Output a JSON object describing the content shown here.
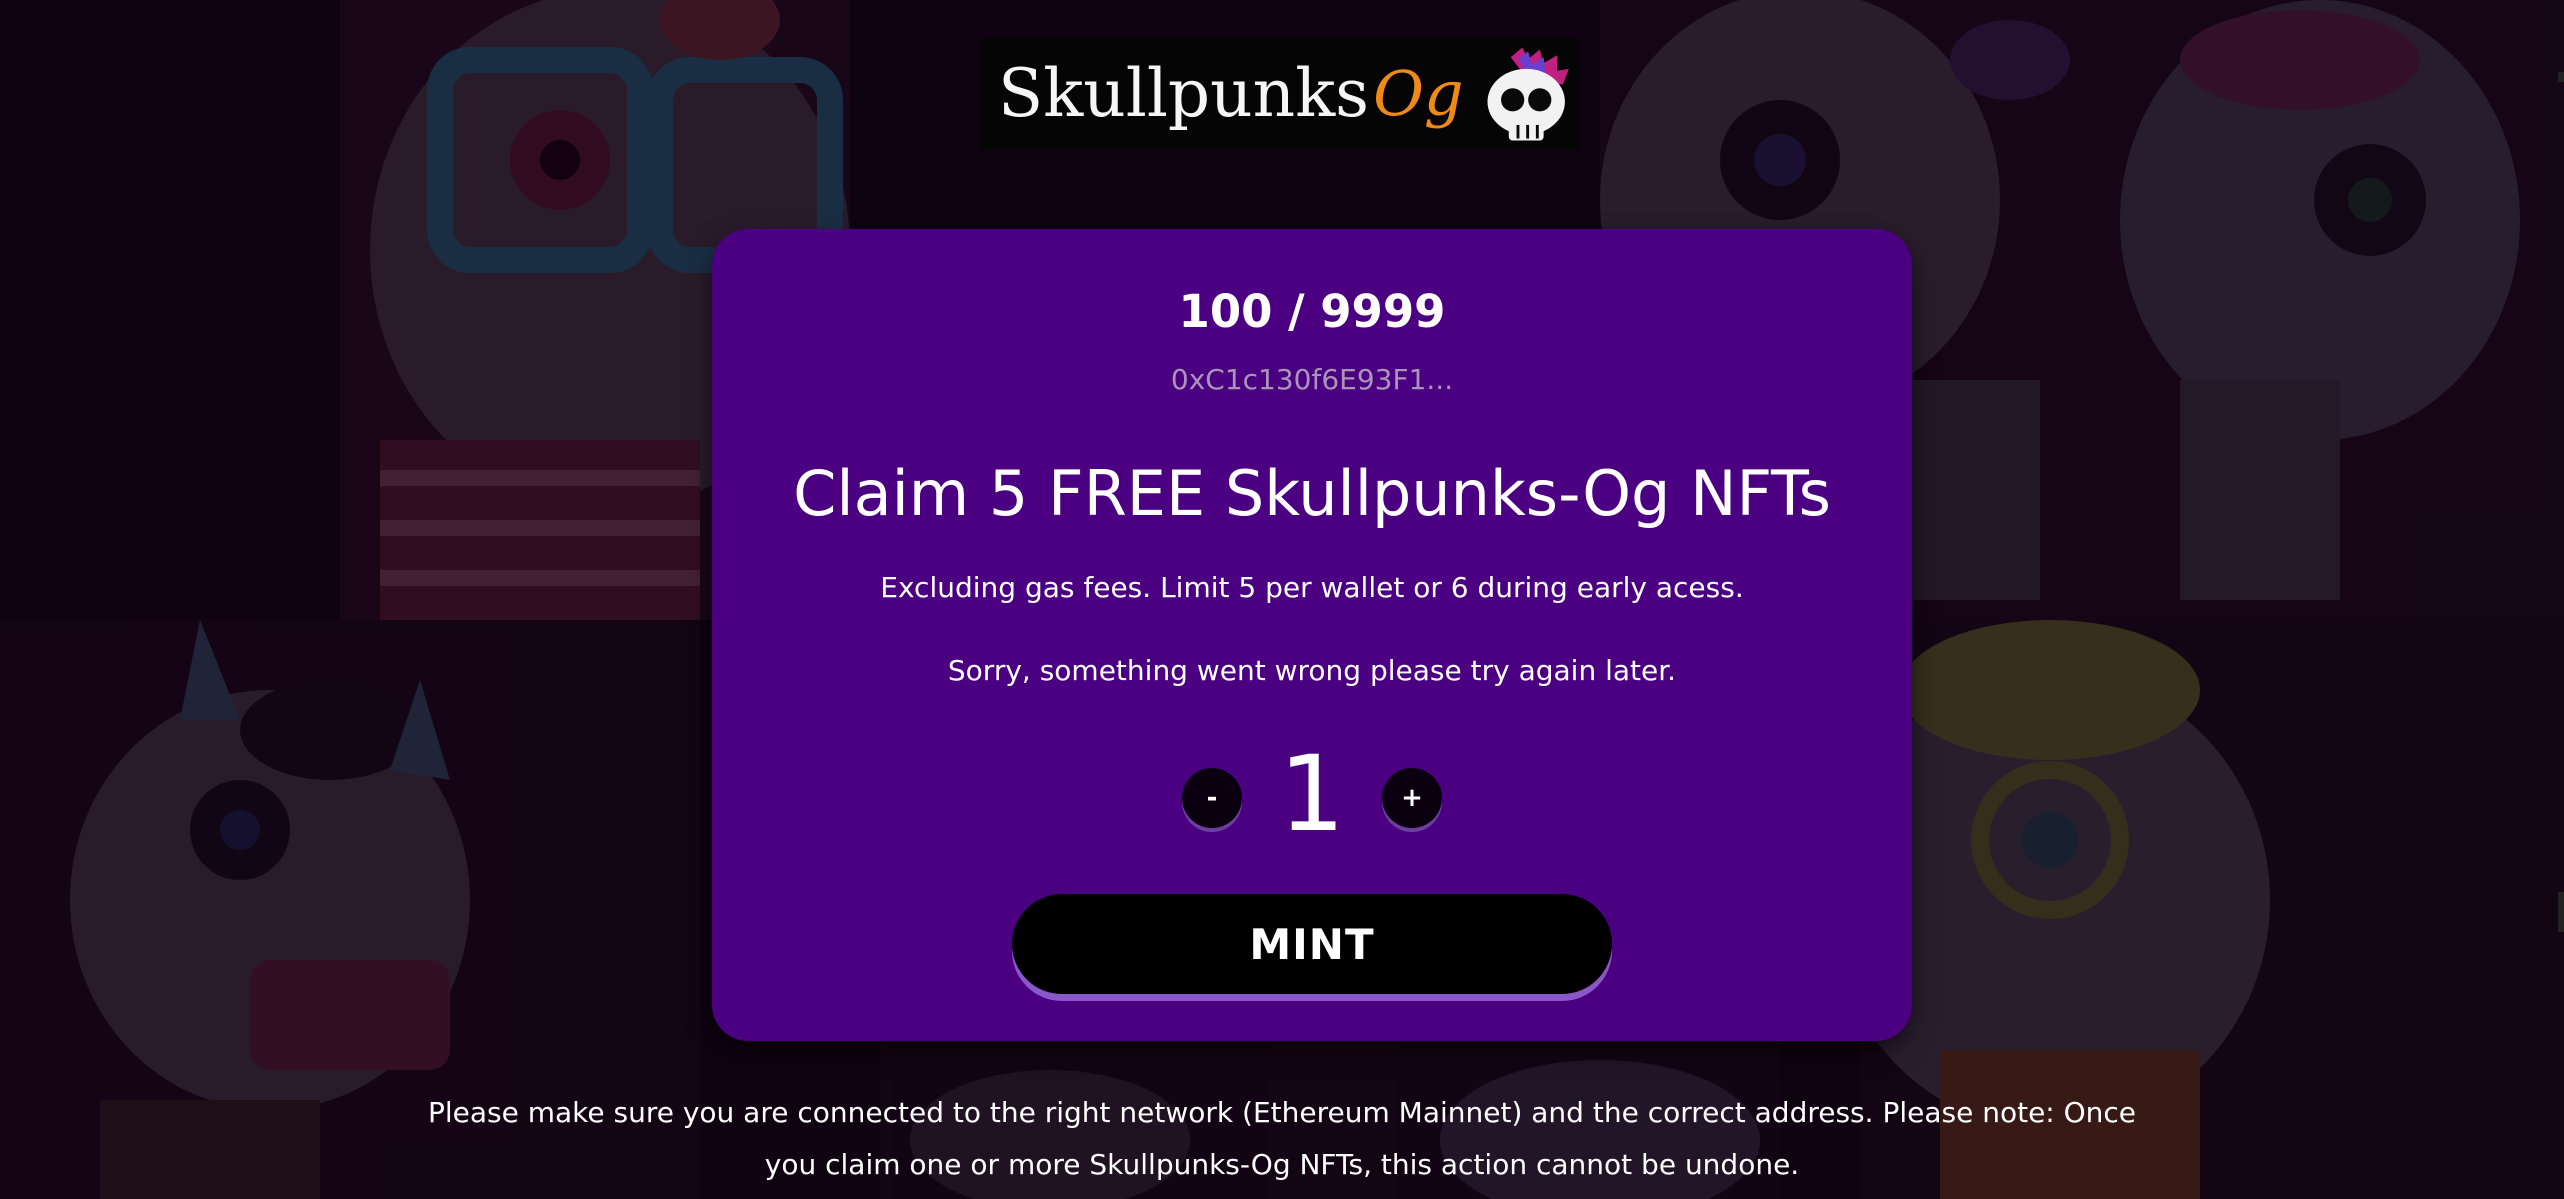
{
  "logo": {
    "word": "Skullpunks",
    "accent": "Og",
    "icon": "skull-mohawk-icon"
  },
  "card": {
    "supply": "100 / 9999",
    "contract": "0xC1c130f6E93F1...",
    "headline": "Claim 5 FREE Skullpunks-Og NFTs",
    "subline": "Excluding gas fees. Limit 5 per wallet or 6 during early acess.",
    "error": "Sorry, something went wrong please try again later.",
    "quantity": {
      "minus_label": "-",
      "value": "1",
      "plus_label": "+"
    },
    "mint_label": "MINT"
  },
  "notice": "Please make sure you are connected to the right network (Ethereum Mainnet) and the correct address. Please note: Once you claim one or more Skullpunks-Og NFTs, this action cannot be undone.",
  "colors": {
    "background": "#0d020d",
    "card": "#4b0082",
    "accent_orange": "#f08a17",
    "button": "#000000"
  }
}
